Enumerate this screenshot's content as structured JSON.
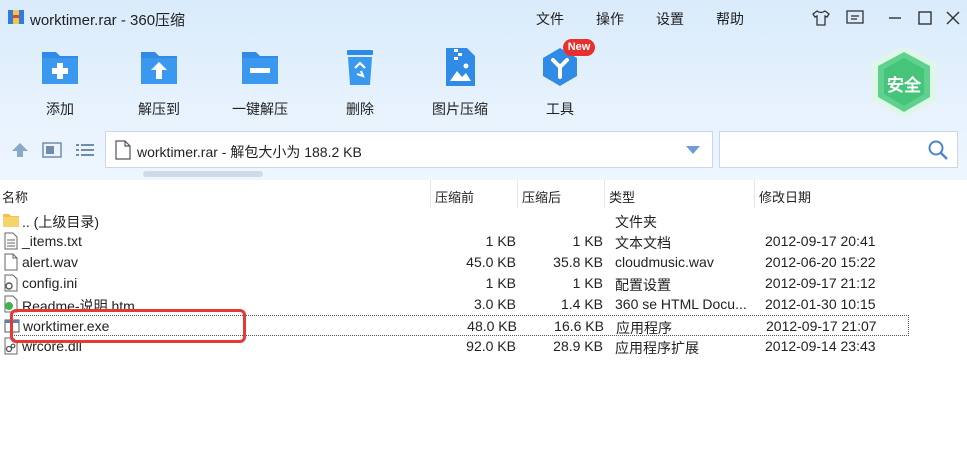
{
  "window": {
    "title": "worktimer.rar - 360压缩"
  },
  "menu": {
    "file": "文件",
    "operate": "操作",
    "settings": "设置",
    "help": "帮助"
  },
  "toolbar": {
    "add": "添加",
    "extract_to": "解压到",
    "one_click_extract": "一键解压",
    "delete": "删除",
    "image_compress": "图片压缩",
    "tools": "工具",
    "new_badge": "New",
    "safe_label": "安全"
  },
  "address": {
    "path": "worktimer.rar - 解包大小为 188.2 KB",
    "search_placeholder": ""
  },
  "columns": {
    "name": "名称",
    "compressed_before": "压缩前",
    "compressed_after": "压缩后",
    "type": "类型",
    "modified": "修改日期"
  },
  "files": [
    {
      "name": ".. (上级目录)",
      "before": "",
      "after": "",
      "type": "文件夹",
      "date": "",
      "icon": "folder-icon"
    },
    {
      "name": "_items.txt",
      "before": "1 KB",
      "after": "1 KB",
      "type": "文本文档",
      "date": "2012-09-17 20:41",
      "icon": "text-file-icon"
    },
    {
      "name": "alert.wav",
      "before": "45.0 KB",
      "after": "35.8 KB",
      "type": "cloudmusic.wav",
      "date": "2012-06-20 15:22",
      "icon": "file-icon"
    },
    {
      "name": "config.ini",
      "before": "1 KB",
      "after": "1 KB",
      "type": "配置设置",
      "date": "2012-09-17 21:12",
      "icon": "settings-file-icon"
    },
    {
      "name": "Readme-说明.htm",
      "before": "3.0 KB",
      "after": "1.4 KB",
      "type": "360 se HTML Docu...",
      "date": "2012-01-30 10:15",
      "icon": "html-file-icon"
    },
    {
      "name": "worktimer.exe",
      "before": "48.0 KB",
      "after": "16.6 KB",
      "type": "应用程序",
      "date": "2012-09-17 21:07",
      "icon": "exe-file-icon"
    },
    {
      "name": "wrcore.dll",
      "before": "92.0 KB",
      "after": "28.9 KB",
      "type": "应用程序扩展",
      "date": "2012-09-14 23:43",
      "icon": "dll-file-icon"
    }
  ],
  "colors": {
    "accent_blue": "#2f8be6",
    "highlight_red": "#e53935",
    "badge_red": "#e8302f",
    "safe_green": "#3fc07a"
  }
}
